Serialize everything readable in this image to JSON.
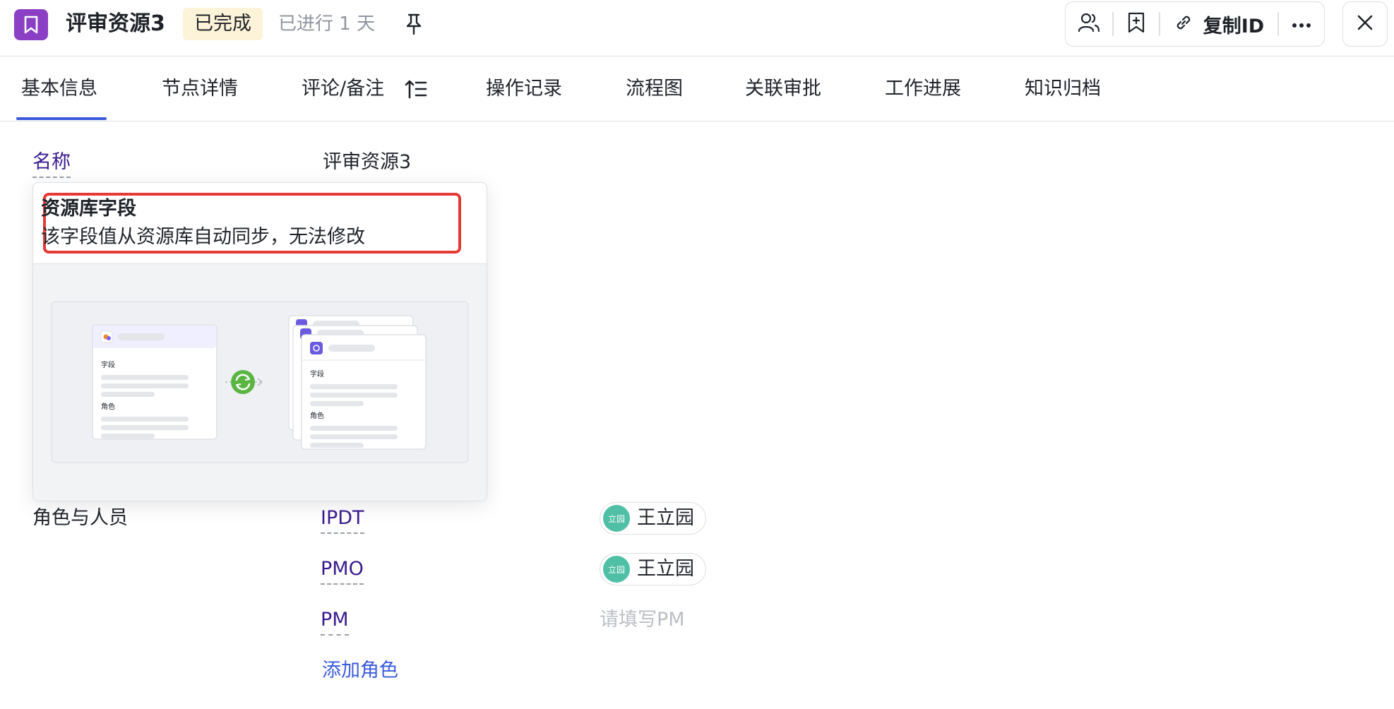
{
  "header": {
    "title": "评审资源3",
    "status": "已完成",
    "elapsed": "已进行 1 天",
    "copy_id_label": "复制ID",
    "icons": [
      "bookmark-icon",
      "pin-icon",
      "members-icon",
      "add-bookmark-icon",
      "link-icon",
      "more-icon",
      "close-icon"
    ]
  },
  "tabs": [
    {
      "label": "基本信息",
      "active": true
    },
    {
      "label": "节点详情"
    },
    {
      "label": "评论/备注"
    },
    {
      "label": "操作记录"
    },
    {
      "label": "流程图"
    },
    {
      "label": "关联审批"
    },
    {
      "label": "工作进展"
    },
    {
      "label": "知识归档"
    }
  ],
  "fields": {
    "name_label": "名称",
    "name_value": "评审资源3",
    "roles_label": "角色与人员"
  },
  "tooltip": {
    "title": "资源库字段",
    "description": "该字段值从资源库自动同步，无法修改",
    "illustration": {
      "left_card": {
        "field_label": "字段",
        "role_label": "角色"
      },
      "right_card": {
        "field_label": "字段",
        "role_label": "角色"
      }
    }
  },
  "roles": [
    {
      "name": "IPDT",
      "person": "王立园",
      "avatar_text": "立园"
    },
    {
      "name": "PMO",
      "person": "王立园",
      "avatar_text": "立园"
    },
    {
      "name": "PM",
      "placeholder": "请填写PM"
    }
  ],
  "add_role_label": "添加角色",
  "colors": {
    "app_icon": "#8b3fc4",
    "status_badge_bg": "#fdf3d8",
    "label_purple": "#3a1b8f",
    "link_blue": "#3b5bdb",
    "highlight_red": "#e53935",
    "avatar_green": "#4fbfa6"
  }
}
